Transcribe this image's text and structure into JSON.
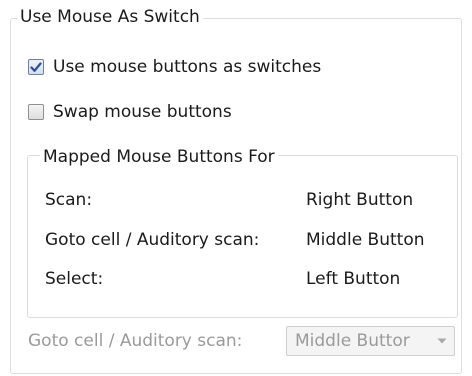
{
  "use_mouse_group": {
    "title": "Use Mouse As Switch",
    "use_buttons_checkbox": {
      "label": "Use mouse buttons as switches",
      "checked": true
    },
    "swap_buttons_checkbox": {
      "label": "Swap mouse buttons",
      "checked": false
    }
  },
  "mapped_group": {
    "title": "Mapped Mouse Buttons For",
    "rows": [
      {
        "action": "Scan:",
        "button": "Right Button"
      },
      {
        "action": "Goto cell / Auditory scan:",
        "button": "Middle Button"
      },
      {
        "action": "Select:",
        "button": "Left Button"
      }
    ]
  },
  "goto_cell_setting": {
    "label": "Goto cell / Auditory scan:",
    "selected": "Middle Buttor",
    "enabled": false
  },
  "icons": {
    "checkmark": "checkmark-icon",
    "dropdown_arrow": "chevron-down-icon"
  },
  "colors": {
    "checkmark": "#2b4f8c",
    "disabled_text": "#9a9a9a",
    "group_border": "#dcdcdc"
  }
}
